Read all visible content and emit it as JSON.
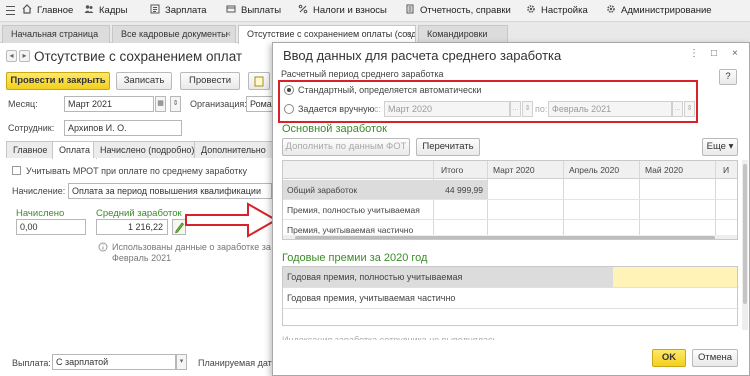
{
  "menu": {
    "items": [
      {
        "label": "Главное",
        "icon": "home-icon"
      },
      {
        "label": "Кадры",
        "icon": "people-icon"
      },
      {
        "label": "Зарплата",
        "icon": "salary-icon"
      },
      {
        "label": "Выплаты",
        "icon": "payments-icon"
      },
      {
        "label": "Налоги и взносы",
        "icon": "taxes-icon"
      },
      {
        "label": "Отчетность, справки",
        "icon": "reports-icon"
      },
      {
        "label": "Настройка",
        "icon": "settings-icon"
      },
      {
        "label": "Администрирование",
        "icon": "admin-icon"
      }
    ]
  },
  "tabs": [
    {
      "label": "Начальная страница"
    },
    {
      "label": "Все кадровые документы"
    },
    {
      "label": "Отсутствие с сохранением оплаты (создание) *"
    },
    {
      "label": "Командировки"
    }
  ],
  "doc": {
    "title": "Отсутствие с сохранением оплат",
    "post_close_label": "Провести и закрыть",
    "save_label": "Записать",
    "post_label": "Провести",
    "month_label": "Месяц:",
    "month_value": "Март 2021",
    "org_label": "Организация:",
    "org_value": "Ромашк",
    "employee_label": "Сотрудник:",
    "employee_value": "Архипов И. О.",
    "subtabs": [
      "Главное",
      "Оплата",
      "Начислено (подробно)",
      "Дополнительно"
    ],
    "mrot_label": "Учитывать МРОТ при оплате по среднему заработку",
    "accrual_label": "Начисление:",
    "accrual_value": "Оплата за период повышения квалификации",
    "accrued_label": "Начислено",
    "accrued_value": "0,00",
    "avg_label": "Средний заработок",
    "avg_value": "1 216,22",
    "info_text_line1": "Использованы данные о заработке за пе",
    "info_text_line2": "Февраль 2021",
    "payout_label": "Выплата:",
    "payout_value": "С зарплатой",
    "planned_label": "Планируемая дата"
  },
  "modal": {
    "title": "Ввод данных для расчета среднего заработка",
    "help_label": "?",
    "period_label": "Расчетный период среднего заработка",
    "radio_auto": "Стандартный, определяется автоматически",
    "radio_manual": "Задается вручную",
    "from_label": "с:",
    "from_value": "Март 2020",
    "to_label": "по:",
    "to_value": "Февраль 2021",
    "main_section": "Основной заработок",
    "fill_fot_label": "Дополнить по данным ФОТ",
    "recalc_label": "Перечитать",
    "more_label": "Еще",
    "grid": {
      "headers": [
        "",
        "Итого",
        "Март 2020",
        "Апрель 2020",
        "Май 2020",
        "И"
      ],
      "rows": [
        {
          "name": "Общий заработок",
          "total": "44 999,99"
        },
        {
          "name": "Премия, полностью учитываемая",
          "total": ""
        },
        {
          "name": "Премия, учитываемая частично",
          "total": ""
        }
      ]
    },
    "bonus_section": "Годовые премии за 2020 год",
    "bonus_rows": [
      "Годовая премия, полностью учитываемая",
      "Годовая премия, учитываемая частично"
    ],
    "footer_text": "Индексация заработка сотрудника не выполнялась",
    "ok_label": "OK",
    "cancel_label": "Отмена"
  },
  "colors": {
    "accent_green": "#3a8b2a",
    "highlight_red": "#d8222b",
    "button_yellow": "#f4cf1e"
  }
}
